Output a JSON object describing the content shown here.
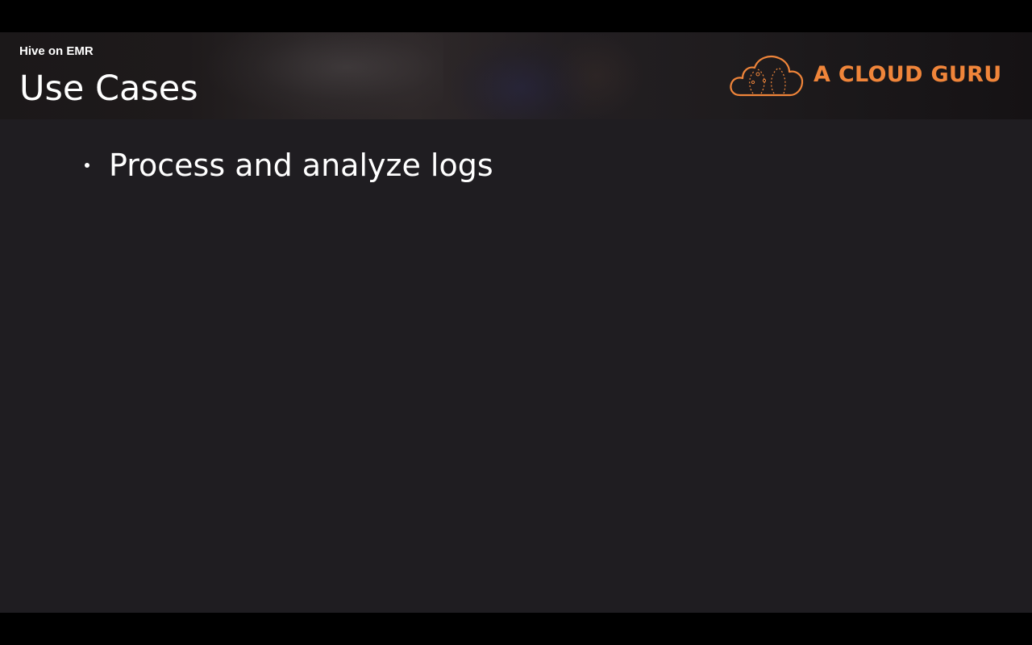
{
  "slide": {
    "subtitle": "Hive on EMR",
    "title": "Use Cases",
    "bullets": [
      "Process and analyze logs"
    ]
  },
  "brand": {
    "logo_text": "A CLOUD GURU",
    "logo_icon": "cloud-logo-icon",
    "accent_color": "#f0853a"
  },
  "colors": {
    "slide_background": "#1f1d21",
    "letterbox": "#000000",
    "text": "#ffffff"
  }
}
